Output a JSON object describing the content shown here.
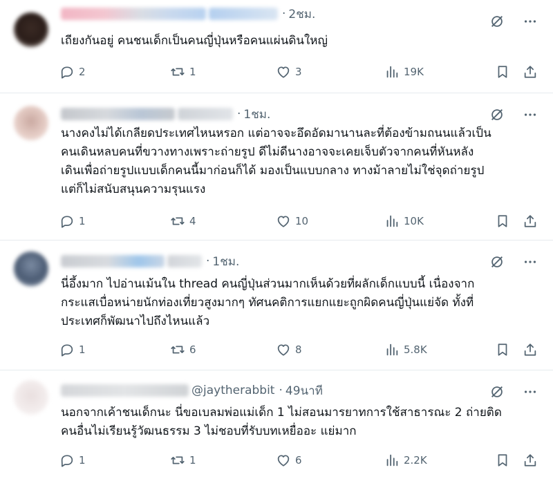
{
  "colors": {
    "text": "#0f1419",
    "secondary": "#536471",
    "divider": "#e6ebee"
  },
  "icons": {
    "reply": "reply-icon",
    "repost": "repost-icon",
    "like": "like-icon",
    "views": "views-icon",
    "bookmark": "bookmark-icon",
    "share": "share-icon",
    "grok": "grok-icon",
    "more": "more-icon"
  },
  "replies": [
    {
      "handle": "",
      "time": "2ชม.",
      "lines": [
        "เถียงกันอยู่ คนชนเด็กเป็นคนญี่ปุ่นหรือคนแผ่นดินใหญ่"
      ],
      "stats": {
        "replies": "2",
        "reposts": "1",
        "likes": "3",
        "views": "19K"
      }
    },
    {
      "handle": "",
      "time": "1ชม.",
      "lines": [
        "นางคงไม่ได้เกลียดประเทศไหนหรอก แต่อาจจะอึดอัดมานานละที่ต้องข้ามถนนแล้วเป็น",
        "คนเดินหลบคนที่ขวางทางเพราะถ่ายรูป ดีไม่ดีนางอาจจะเคยเจ็บตัวจากคนที่หันหลัง",
        "เดินเพื่อถ่ายรูปแบบเด็กคนนี้มาก่อนก็ได้ มองเป็นแบบกลาง ทางม้าลายไม่ใช่จุดถ่ายรูป",
        "แต่ก็ไม่สนับสนุนความรุนแรง"
      ],
      "stats": {
        "replies": "1",
        "reposts": "4",
        "likes": "10",
        "views": "10K"
      }
    },
    {
      "handle": "",
      "time": "1ชม.",
      "lines": [
        "นี่อึ้งมาก ไปอ่านเม้นใน thread คนญี่ปุ่นส่วนมากเห็นด้วยที่ผลักเด็กแบบนี้ เนื่องจาก",
        "กระแสเบื่อหน่ายนักท่องเที่ยวสูงมากๆ ทัศนคติการแยกแยะถูกผิดคนญี่ปุ่นแย่จัด ทั้งที่",
        "ประเทศก็พัฒนาไปถึงไหนแล้ว"
      ],
      "stats": {
        "replies": "1",
        "reposts": "6",
        "likes": "8",
        "views": "5.8K"
      }
    },
    {
      "handle": "@jaytherabbit",
      "time": "49นาที",
      "lines": [
        "นอกจากเค้าชนเด็กนะ นี่ขอเบลมพ่อแม่เด็ก 1 ไม่สอนมารยาทการใช้สาธารณะ 2 ถ่ายติด",
        "คนอื่นไม่เรียนรู้วัฒนธรรม 3 ไม่ชอบที่รับบทเหยื่ออะ แย่มาก"
      ],
      "stats": {
        "replies": "1",
        "reposts": "1",
        "likes": "6",
        "views": "2.2K"
      }
    }
  ]
}
